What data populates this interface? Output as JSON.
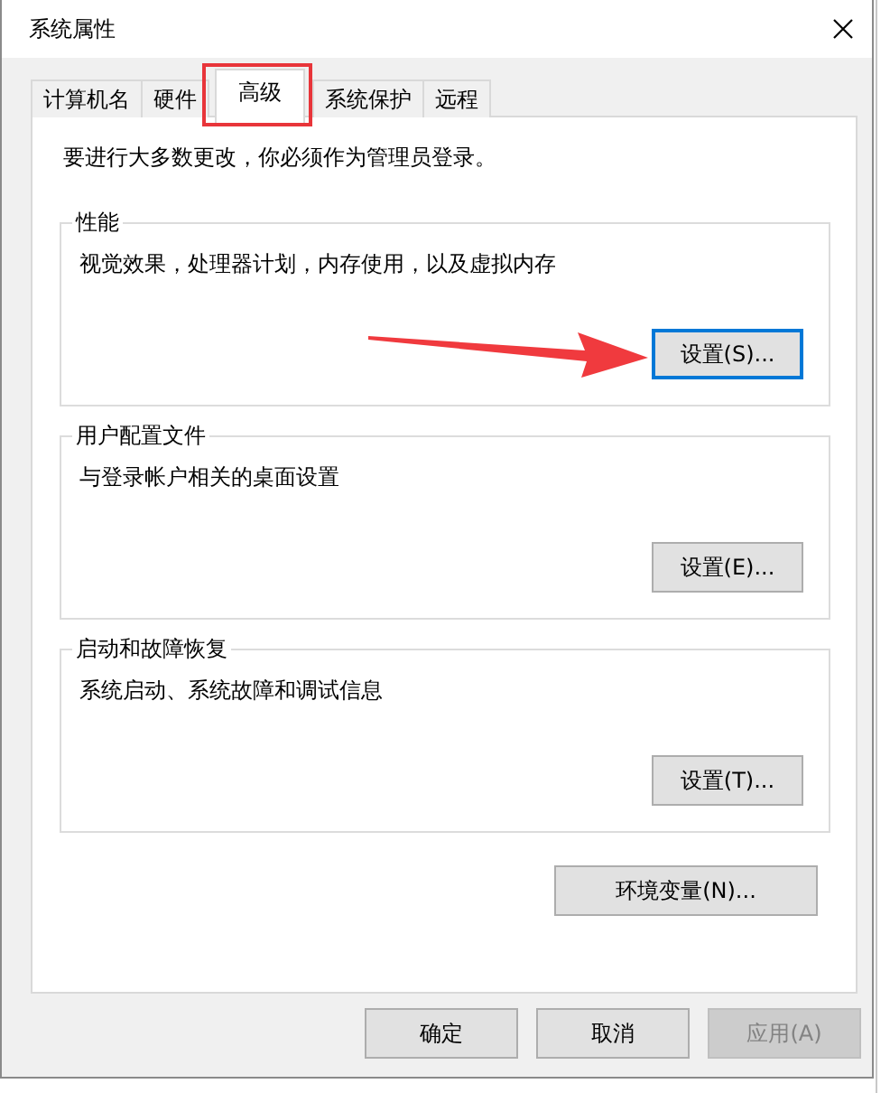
{
  "window": {
    "title": "系统属性"
  },
  "tabs": [
    {
      "label": "计算机名",
      "selected": false
    },
    {
      "label": "硬件",
      "selected": false
    },
    {
      "label": "高级",
      "selected": true
    },
    {
      "label": "系统保护",
      "selected": false
    },
    {
      "label": "远程",
      "selected": false
    }
  ],
  "notice": "要进行大多数更改，你必须作为管理员登录。",
  "groups": [
    {
      "title": "性能",
      "description": "视觉效果，处理器计划，内存使用，以及虚拟内存",
      "button": {
        "label": "设置(S)...",
        "focused": true
      }
    },
    {
      "title": "用户配置文件",
      "description": "与登录帐户相关的桌面设置",
      "button": {
        "label": "设置(E)...",
        "focused": false
      }
    },
    {
      "title": "启动和故障恢复",
      "description": "系统启动、系统故障和调试信息",
      "button": {
        "label": "设置(T)...",
        "focused": false
      }
    }
  ],
  "env_button": {
    "label": "环境变量(N)..."
  },
  "buttons": [
    {
      "label": "确定",
      "disabled": false
    },
    {
      "label": "取消",
      "disabled": false
    },
    {
      "label": "应用(A)",
      "disabled": true
    }
  ]
}
